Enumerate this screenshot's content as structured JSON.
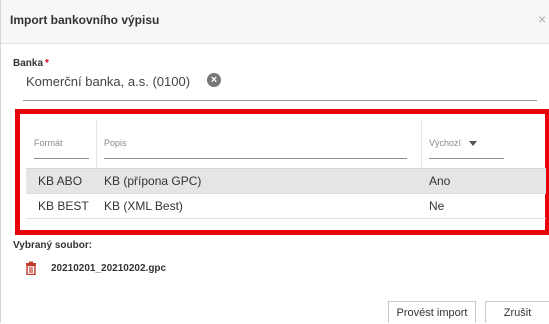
{
  "dialog": {
    "title": "Import bankovního výpisu",
    "close_glyph": "×"
  },
  "bank": {
    "label": "Banka",
    "required_mark": "*",
    "value": "Komerční banka, a.s. (0100)",
    "clear_glyph": "×"
  },
  "table": {
    "columns": [
      "Formát",
      "Popis",
      "Výchozí"
    ],
    "rows": [
      {
        "format": "KB ABO",
        "description": "KB (přípona GPC)",
        "default": "Ano",
        "selected": true
      },
      {
        "format": "KB BEST",
        "description": "KB (XML Best)",
        "default": "Ne",
        "selected": false
      }
    ]
  },
  "selected_file": {
    "label": "Vybraný soubor:",
    "name": "20210201_20210202.gpc"
  },
  "actions": {
    "import_label": "Provést import",
    "cancel_label": "Zrušit"
  },
  "colors": {
    "highlight_border": "#e8000b",
    "required": "#d0021b",
    "file_icon": "#c0392b",
    "selected_row": "#e5e5e5"
  }
}
